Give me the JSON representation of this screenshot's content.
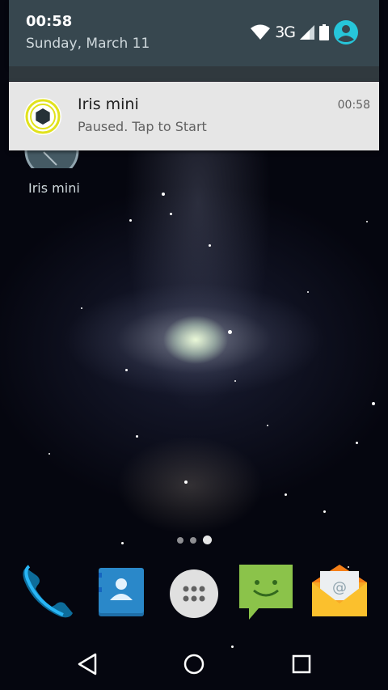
{
  "status_bar": {
    "time": "00:58",
    "date": "Sunday, March 11",
    "network": "3G",
    "icons": [
      "wifi-icon",
      "signal-icon",
      "battery-icon",
      "account-icon"
    ]
  },
  "notification": {
    "app_name": "Iris mini",
    "message": "Paused. Tap to Start",
    "time": "00:58",
    "icon": "iris-aperture-icon"
  },
  "home": {
    "app_label": "Iris mini",
    "page_count": 3,
    "active_page": 3
  },
  "dock": {
    "apps": [
      "phone-icon",
      "contacts-icon",
      "app-drawer-icon",
      "messaging-icon",
      "email-icon"
    ]
  },
  "nav_bar": {
    "buttons": [
      "back-icon",
      "home-icon",
      "recents-icon"
    ]
  },
  "colors": {
    "shade": "#37474f",
    "notification_bg": "#e6e6e6",
    "accent": "#26c6da"
  }
}
